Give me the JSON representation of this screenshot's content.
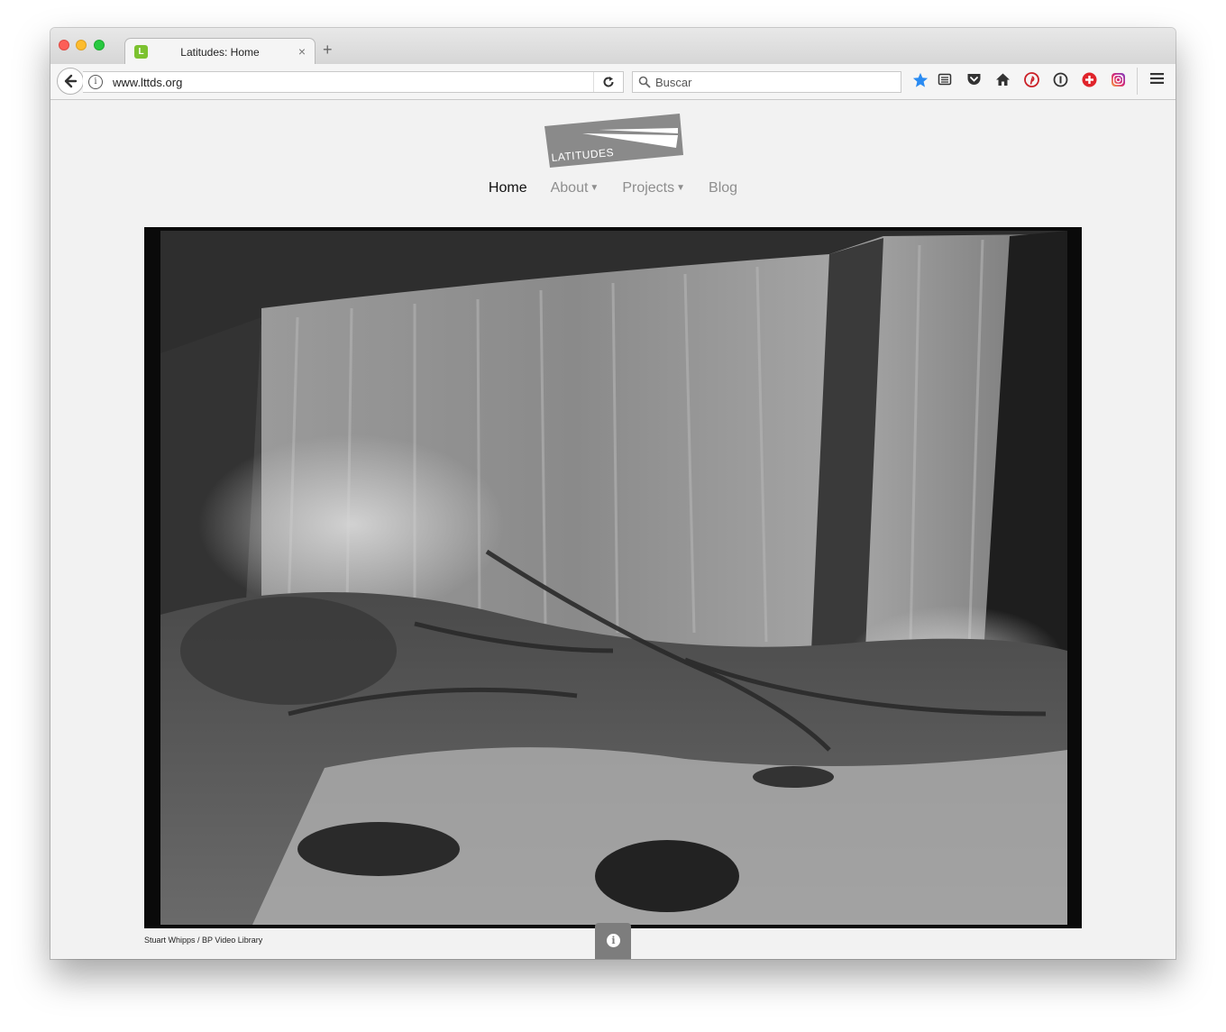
{
  "browser": {
    "tab_title": "Latitudes: Home",
    "tab_favicon_letter": "L",
    "tab_close": "×",
    "new_tab": "+",
    "url": "www.lttds.org",
    "search_placeholder": "Buscar",
    "toolbar_icons": [
      "back-icon",
      "info-icon",
      "reload-icon",
      "search-icon",
      "bookmark-star-icon",
      "reading-list-icon",
      "pocket-icon",
      "home-icon",
      "pinterest-icon",
      "onepassword-icon",
      "plus-addon-icon",
      "instagram-icon",
      "menu-icon"
    ]
  },
  "site": {
    "logo_text": "LATITUDES",
    "nav": [
      {
        "label": "Home",
        "active": true
      },
      {
        "label": "About",
        "dropdown": true
      },
      {
        "label": "Projects",
        "dropdown": true
      },
      {
        "label": "Blog"
      }
    ],
    "hero_caption": "Stuart Whipps / BP Video Library"
  },
  "colors": {
    "nav_active": "#111111",
    "nav_inactive": "#8e8e8e",
    "logo_bg": "#8a8a8a",
    "info_tab": "#7d7d7d",
    "star_blue": "#2a8bf2",
    "pinterest_red": "#cb2027",
    "addon_red": "#e0242b"
  }
}
